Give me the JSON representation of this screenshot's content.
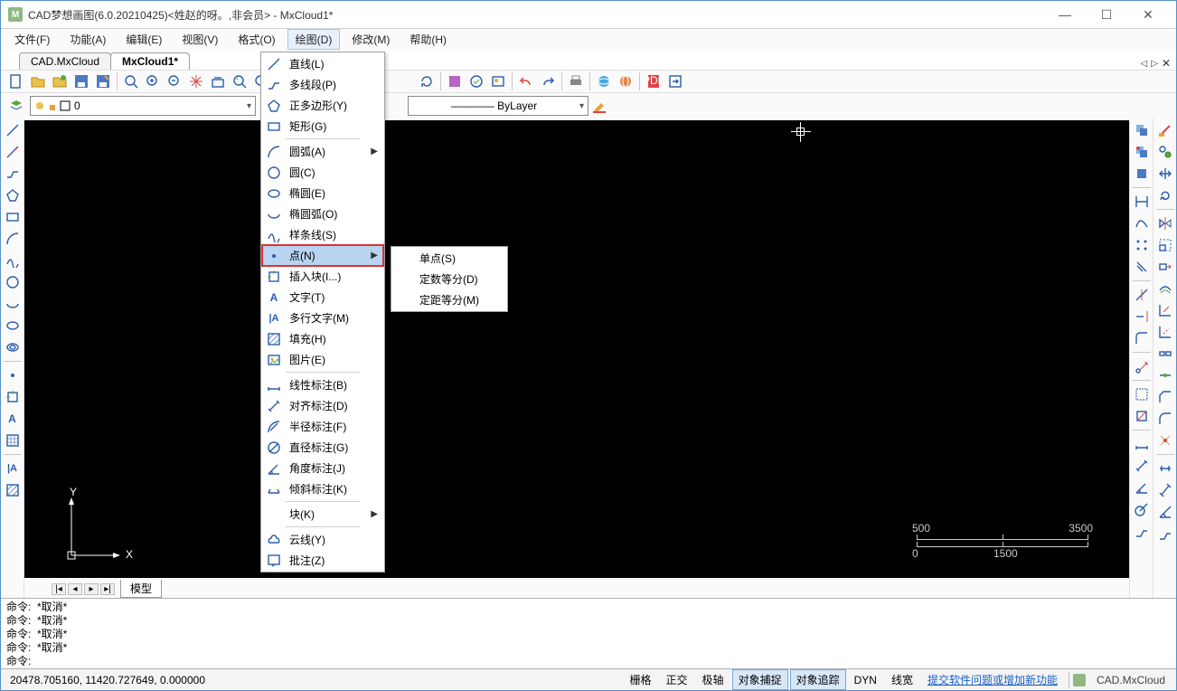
{
  "window": {
    "title": "CAD梦想画图(6.0.20210425)<姓赵的呀。,非会员> - MxCloud1*"
  },
  "menubar": {
    "items": [
      {
        "label": "文件(F)"
      },
      {
        "label": "功能(A)"
      },
      {
        "label": "编辑(E)"
      },
      {
        "label": "视图(V)"
      },
      {
        "label": "格式(O)"
      },
      {
        "label": "绘图(D)",
        "open": true
      },
      {
        "label": "修改(M)"
      },
      {
        "label": "帮助(H)"
      }
    ]
  },
  "doctabs": {
    "tabs": [
      {
        "label": "CAD.MxCloud"
      },
      {
        "label": "MxCloud1*",
        "active": true
      }
    ]
  },
  "layerbar": {
    "layer_value": "0",
    "linetype_value": "ByLayer"
  },
  "draw_menu": {
    "items": [
      {
        "icon": "line-icon",
        "label": "直线(L)"
      },
      {
        "icon": "polyline-icon",
        "label": "多线段(P)"
      },
      {
        "icon": "polygon-icon",
        "label": "正多边形(Y)"
      },
      {
        "icon": "rect-icon",
        "label": "矩形(G)"
      },
      {
        "sep": true
      },
      {
        "icon": "arc-icon",
        "label": "圆弧(A)",
        "arrow": true
      },
      {
        "icon": "circle-icon",
        "label": "圆(C)"
      },
      {
        "icon": "ellipse-icon",
        "label": "椭圆(E)"
      },
      {
        "icon": "ellipsearc-icon",
        "label": "椭圆弧(O)"
      },
      {
        "icon": "spline-icon",
        "label": "样条线(S)"
      },
      {
        "icon": "point-icon",
        "label": "点(N)",
        "arrow": true,
        "hl": true
      },
      {
        "icon": "block-icon",
        "label": "插入块(I...)"
      },
      {
        "icon": "text-icon",
        "label": "文字(T)"
      },
      {
        "icon": "mtext-icon",
        "label": "多行文字(M)"
      },
      {
        "icon": "hatch-icon",
        "label": "填充(H)"
      },
      {
        "icon": "image-icon",
        "label": "图片(E)"
      },
      {
        "sep": true
      },
      {
        "icon": "dimlin-icon",
        "label": "线性标注(B)"
      },
      {
        "icon": "dimali-icon",
        "label": "对齐标注(D)"
      },
      {
        "icon": "dimrad-icon",
        "label": "半径标注(F)"
      },
      {
        "icon": "dimdia-icon",
        "label": "直径标注(G)"
      },
      {
        "icon": "dimang-icon",
        "label": "角度标注(J)"
      },
      {
        "icon": "dimobl-icon",
        "label": "倾斜标注(K)"
      },
      {
        "sep": true
      },
      {
        "icon": "block2-icon",
        "label": "块(K)",
        "arrow": true
      },
      {
        "sep": true
      },
      {
        "icon": "cloud-icon",
        "label": "云线(Y)"
      },
      {
        "icon": "note-icon",
        "label": "批注(Z)"
      }
    ]
  },
  "submenu": {
    "items": [
      {
        "label": "单点(S)"
      },
      {
        "label": "定数等分(D)"
      },
      {
        "label": "定距等分(M)"
      }
    ]
  },
  "ruler": {
    "top_left": "500",
    "top_right": "3500",
    "bot_center": "1500",
    "bot_left": "0"
  },
  "ucs": {
    "x": "X",
    "y": "Y"
  },
  "sheettabs": {
    "tab": "模型"
  },
  "cmdwin": {
    "lines": [
      "命令:  *取消*",
      "命令:  *取消*",
      "命令:  *取消*",
      "命令:  *取消*",
      "命令:"
    ]
  },
  "statusbar": {
    "coords": "20478.705160,  11420.727649,  0.000000",
    "buttons": [
      {
        "label": "栅格"
      },
      {
        "label": "正交"
      },
      {
        "label": "极轴"
      },
      {
        "label": "对象捕捉",
        "active": true
      },
      {
        "label": "对象追踪",
        "active": true
      },
      {
        "label": "DYN"
      },
      {
        "label": "线宽"
      }
    ],
    "link": "提交软件问题或增加新功能",
    "brand": "CAD.MxCloud"
  }
}
